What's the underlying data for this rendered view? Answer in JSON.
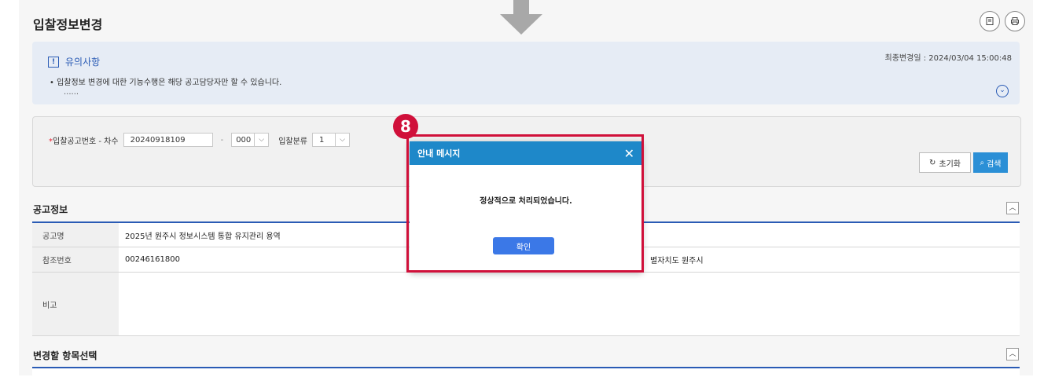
{
  "page": {
    "title": "입찰정보변경",
    "icons": [
      "bookmark-icon",
      "print-icon"
    ]
  },
  "notice": {
    "heading": "유의사항",
    "line1": "• 입찰정보 변경에 대한 기능수행은 해당 공고담당자만 할 수 있습니다.",
    "line2": "......",
    "last_changed": "최종변경일 : 2024/03/04 15:00:48"
  },
  "search": {
    "label": "입찰공고번호 - 차수",
    "notice_no": "20240918109",
    "sep": "-",
    "seq": "000",
    "category_label": "입찰분류",
    "category": "1",
    "reset_label": "초기화",
    "search_label": "검색"
  },
  "info": {
    "title": "공고정보",
    "rows": [
      {
        "label": "공고명",
        "value": "2025년 원주시 정보시스템 통합 유지관리 용역"
      },
      {
        "label": "참조번호",
        "value": "00246161800",
        "extra": "별자치도 원주시"
      },
      {
        "label": "비고",
        "value": ""
      }
    ]
  },
  "section2": {
    "title": "변경할 항목선택"
  },
  "dialog": {
    "title": "안내 메시지",
    "message": "정상적으로 처리되었습니다.",
    "ok_label": "확인"
  },
  "annotation": {
    "badge": "8"
  },
  "colors": {
    "accent": "#1e88c9",
    "highlight": "#d0103a",
    "ok_button": "#3b78e7"
  }
}
